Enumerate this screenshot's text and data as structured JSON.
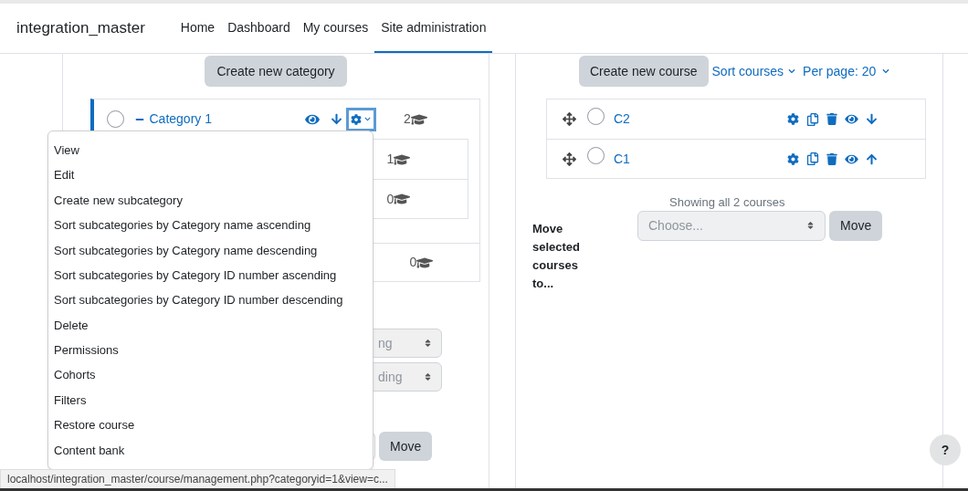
{
  "site_name": "integration_master",
  "nav": [
    {
      "label": "Home",
      "selected": false
    },
    {
      "label": "Dashboard",
      "selected": false
    },
    {
      "label": "My courses",
      "selected": false
    },
    {
      "label": "Site administration",
      "selected": true
    }
  ],
  "category_panel": {
    "create_button": "Create new category",
    "category": {
      "name": "Category 1",
      "expanded": true,
      "count": "2",
      "checked": false
    },
    "subcategory_counts": [
      "1",
      "0"
    ],
    "other_count": "0",
    "sort_selects": [
      "ng",
      "ding"
    ],
    "move_button": "Move"
  },
  "menu": {
    "items": [
      "View",
      "Edit",
      "Create new subcategory",
      "Sort subcategories by Category name ascending",
      "Sort subcategories by Category name descending",
      "Sort subcategories by Category ID number ascending",
      "Sort subcategories by Category ID number descending",
      "Delete",
      "Permissions",
      "Cohorts",
      "Filters",
      "Restore course",
      "Content bank"
    ]
  },
  "course_panel": {
    "create_button": "Create new course",
    "sort_link": "Sort courses",
    "per_page_link": "Per page: 20",
    "courses": [
      {
        "name": "C2",
        "checked": false,
        "can_move_down": true
      },
      {
        "name": "C1",
        "checked": false,
        "can_move_down": false
      }
    ],
    "showing": "Showing all 2 courses",
    "move_label": "Move selected courses to...",
    "move_placeholder": "Choose...",
    "move_button": "Move"
  },
  "help_button": "?",
  "status_url": "localhost/integration_master/course/management.php?categoryid=1&view=c..."
}
